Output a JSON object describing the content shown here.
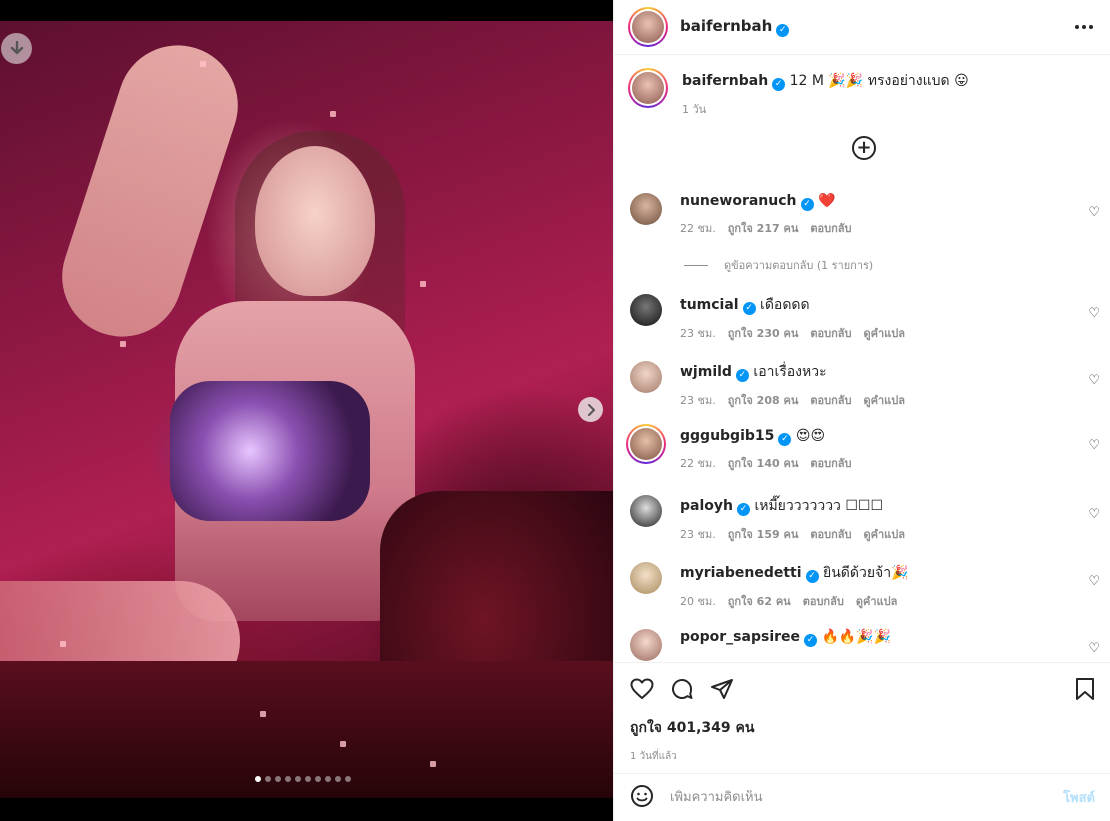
{
  "post": {
    "username": "baifernbah",
    "caption_meta": "12 M",
    "caption_text": "🎉🎉 ทรงอย่างแบด 😛",
    "caption_age": "1 วัน"
  },
  "comments": [
    {
      "user": "nuneworanuch",
      "text": "❤️",
      "age": "22 ชม.",
      "likes": "ถูกใจ 217 คน",
      "reply": "ตอบกลับ",
      "translate": "",
      "avatar_color": "#8a6b5a"
    },
    {
      "user": "tumcial",
      "text": "เดือดดด",
      "age": "23 ชม.",
      "likes": "ถูกใจ 230 คน",
      "reply": "ตอบกลับ",
      "translate": "ดูคำแปล",
      "avatar_color": "#3a3a3a"
    },
    {
      "user": "wjmild",
      "text": "เอาเรื่องหวะ",
      "age": "23 ชม.",
      "likes": "ถูกใจ 208 คน",
      "reply": "ตอบกลับ",
      "translate": "ดูคำแปล",
      "avatar_color": "#c9a58f"
    },
    {
      "user": "gggubgib15",
      "text": "😍😍",
      "age": "22 ชม.",
      "likes": "ถูกใจ 140 คน",
      "reply": "ตอบกลับ",
      "translate": "",
      "avatar_color": "#b0806a"
    },
    {
      "user": "paloyh",
      "text": "เหมี๊ยววววววว ☐☐☐",
      "age": "23 ชม.",
      "likes": "ถูกใจ 159 คน",
      "reply": "ตอบกลับ",
      "translate": "ดูคำแปล",
      "avatar_color": "#2b2b2b"
    },
    {
      "user": "myriabenedetti",
      "text": "ยินดีด้วยจ้า🎉",
      "age": "20 ชม.",
      "likes": "ถูกใจ 62 คน",
      "reply": "ตอบกลับ",
      "translate": "ดูคำแปล",
      "avatar_color": "#a08a6a"
    },
    {
      "user": "popor_sapsiree",
      "text": "🔥🔥🎉🎉",
      "age": "",
      "likes": "",
      "reply": "",
      "translate": "",
      "avatar_color": "#d1a89a"
    }
  ],
  "view_replies": "ดูข้อความตอบกลับ (1 รายการ)",
  "likes_count": "ถูกใจ 401,349 คน",
  "post_age": "1 วันที่แล้ว",
  "composer": {
    "placeholder": "เพิ่มความคิดเห็น",
    "post_label": "โพสต์"
  },
  "icons": {
    "download": "download-icon",
    "next": "chevron-right-icon",
    "more": "more-options-icon",
    "add": "plus-circle-icon",
    "like": "heart-icon",
    "comment": "comment-icon",
    "share": "send-icon",
    "save": "bookmark-icon",
    "emoji": "emoji-icon"
  },
  "carousel": {
    "count": 10,
    "active": 0
  },
  "colors": {
    "verified": "#0095f6",
    "muted": "#8e8e8e",
    "post_button": "#b2dffc"
  }
}
